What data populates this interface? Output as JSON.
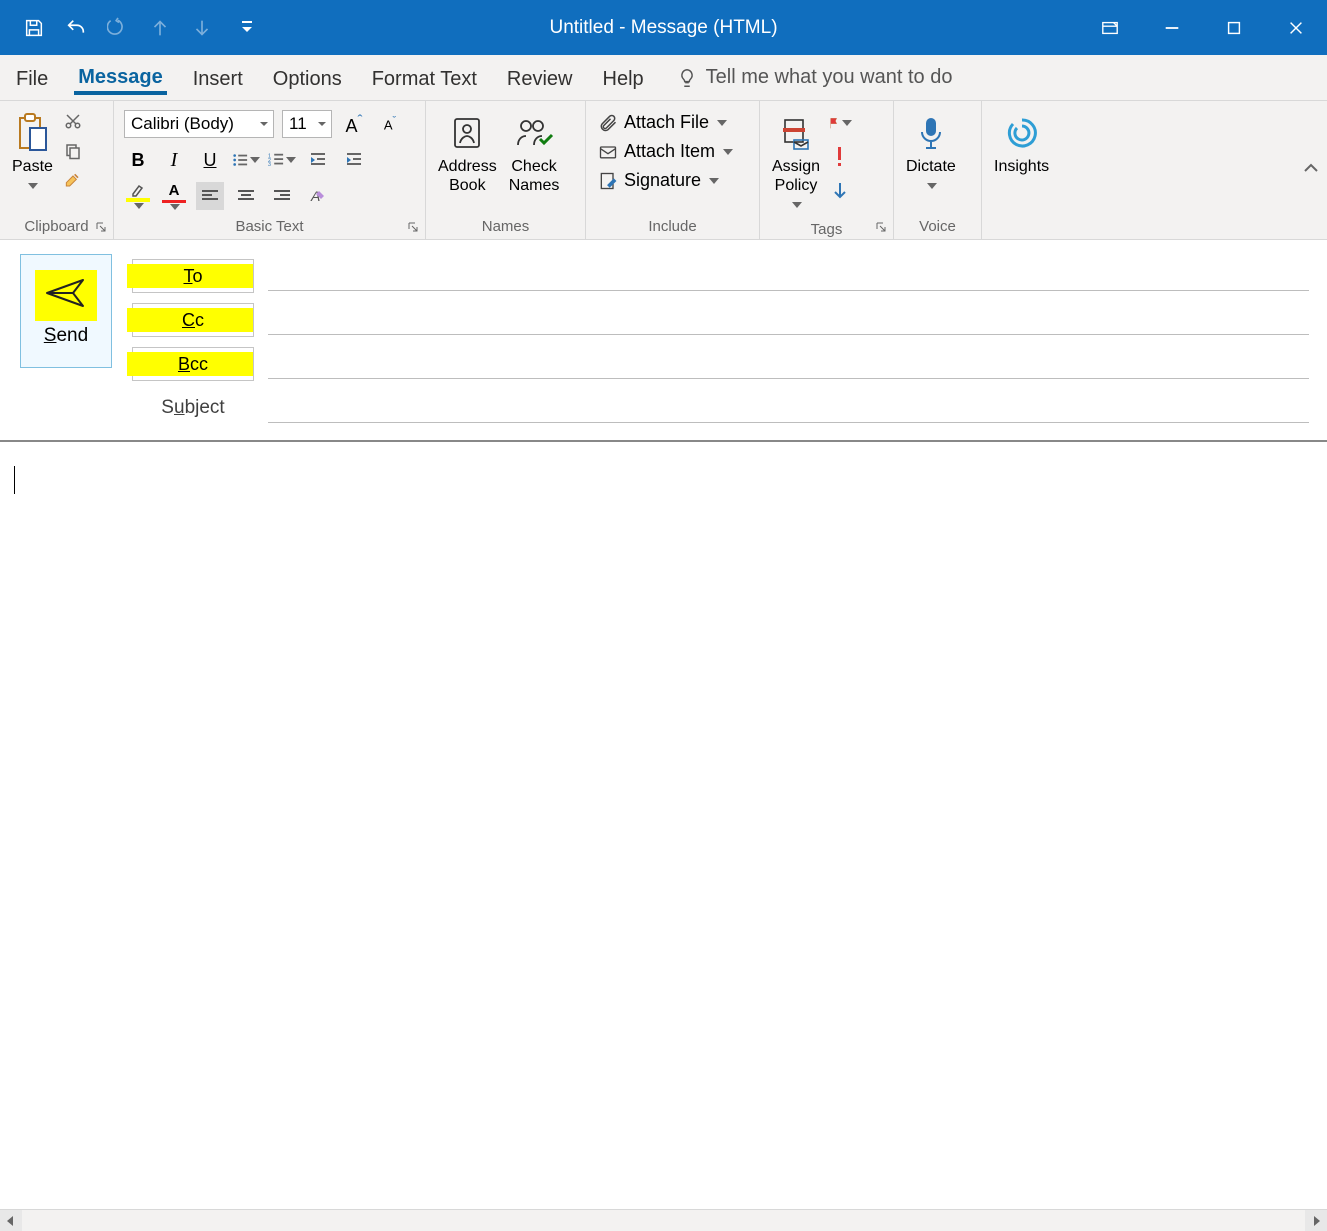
{
  "title": "Untitled  -  Message (HTML)",
  "tabs": {
    "file": "File",
    "message": "Message",
    "insert": "Insert",
    "options": "Options",
    "format": "Format Text",
    "review": "Review",
    "help": "Help",
    "tellme": "Tell me what you want to do"
  },
  "ribbon": {
    "clipboard": {
      "paste": "Paste",
      "label": "Clipboard"
    },
    "basic": {
      "font": "Calibri (Body)",
      "size": "11",
      "label": "Basic Text"
    },
    "names": {
      "address": "Address\nBook",
      "check": "Check\nNames",
      "label": "Names"
    },
    "include": {
      "attachfile": "Attach File",
      "attachitem": "Attach Item",
      "signature": "Signature",
      "label": "Include"
    },
    "tags": {
      "assign": "Assign\nPolicy",
      "label": "Tags"
    },
    "voice": {
      "dictate": "Dictate",
      "label": "Voice"
    },
    "insights": {
      "label": "Insights"
    }
  },
  "compose": {
    "send": "Send",
    "to": "To",
    "cc": "Cc",
    "bcc": "Bcc",
    "subject": "Subject"
  }
}
